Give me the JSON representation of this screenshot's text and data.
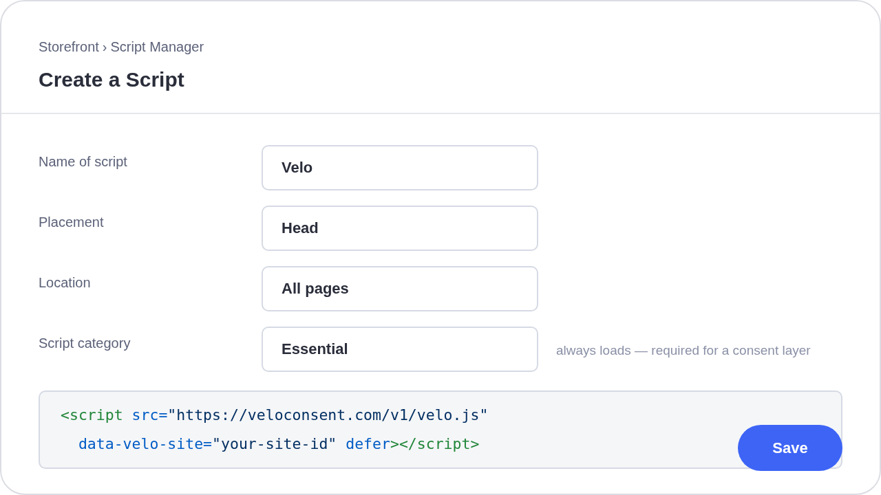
{
  "breadcrumb": {
    "items": [
      "Storefront",
      "Script Manager"
    ],
    "separator": "›"
  },
  "title": "Create a Script",
  "form": {
    "fields": [
      {
        "label": "Name of script",
        "value": "Velo"
      },
      {
        "label": "Placement",
        "value": "Head"
      },
      {
        "label": "Location",
        "value": "All pages"
      },
      {
        "label": "Script category",
        "value": "Essential",
        "hint": "always loads — required for a consent layer"
      }
    ]
  },
  "code": {
    "lines": [
      [
        {
          "kind": "tag",
          "text": "<script"
        },
        {
          "kind": "attr",
          "text": " src="
        },
        {
          "kind": "string",
          "text": "\"https://veloconsent.com/v1/velo.js\""
        }
      ],
      [
        {
          "kind": "attr",
          "text": "  data-velo-site="
        },
        {
          "kind": "string",
          "text": "\"your-site-id\""
        },
        {
          "kind": "attr",
          "text": " defer"
        },
        {
          "kind": "tag",
          "text": "></script>"
        }
      ]
    ]
  },
  "save_button": "Save"
}
